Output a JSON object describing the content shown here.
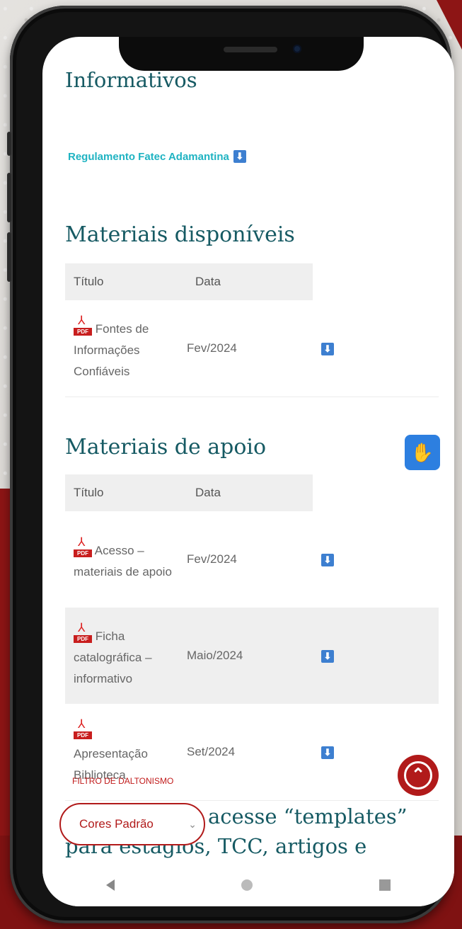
{
  "informativos": {
    "heading": "Informativos",
    "link": "Regulamento Fatec Adamantina",
    "link_icon": "download-icon"
  },
  "disponiveis": {
    "heading": "Materiais disponíveis",
    "columns": [
      "Título",
      "Data"
    ],
    "rows": [
      {
        "title": "Fontes de Informações Confiáveis",
        "date": "Fev/2024",
        "icon": "pdf-icon"
      }
    ]
  },
  "apoio": {
    "heading": "Materiais de apoio",
    "columns": [
      "Título",
      "Data"
    ],
    "rows": [
      {
        "title": "Acesso – materiais de apoio",
        "date": "Fev/2024",
        "icon": "pdf-icon"
      },
      {
        "title": "Ficha catalográfica – informativo",
        "date": "Maio/2024",
        "icon": "pdf-icon"
      },
      {
        "title": "Apresentação Biblioteca",
        "date": "Set/2024",
        "icon": "pdf-icon"
      }
    ]
  },
  "filter": {
    "label": "FILTRO DE DALTONISMO",
    "value": "Cores Padrão"
  },
  "templates_heading": "Documentos: acesse “templates” para estágios, TCC, artigos e",
  "pdf_tag": "PDF",
  "colors": {
    "heading": "#165a63",
    "link": "#1fb3c2",
    "accent_red": "#b11a1a",
    "download": "#3d7fd0",
    "libras": "#2d7fe0"
  }
}
